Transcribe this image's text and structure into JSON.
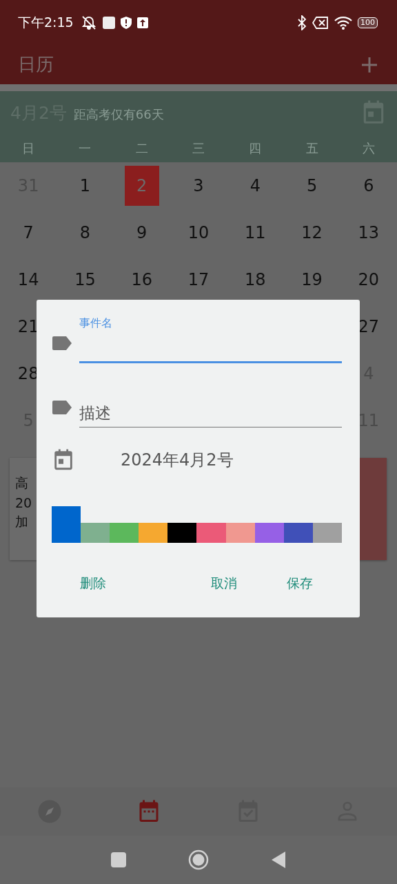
{
  "status_bar": {
    "time": "下午2:15",
    "battery": "100"
  },
  "app_bar": {
    "title": "日历"
  },
  "header": {
    "date": "4月2号",
    "countdown": "距高考仅有66天",
    "weekdays": [
      "日",
      "一",
      "二",
      "三",
      "四",
      "五",
      "六"
    ]
  },
  "calendar": {
    "rows": [
      {
        "cells": [
          {
            "day": "31",
            "other_month": true,
            "selected": false
          },
          {
            "day": "1",
            "other_month": false,
            "selected": false
          },
          {
            "day": "2",
            "other_month": false,
            "selected": true
          },
          {
            "day": "3",
            "other_month": false,
            "selected": false
          },
          {
            "day": "4",
            "other_month": false,
            "selected": false
          },
          {
            "day": "5",
            "other_month": false,
            "selected": false
          },
          {
            "day": "6",
            "other_month": false,
            "selected": false
          }
        ]
      },
      {
        "cells": [
          {
            "day": "7",
            "other_month": false,
            "selected": false
          },
          {
            "day": "8",
            "other_month": false,
            "selected": false
          },
          {
            "day": "9",
            "other_month": false,
            "selected": false
          },
          {
            "day": "10",
            "other_month": false,
            "selected": false
          },
          {
            "day": "11",
            "other_month": false,
            "selected": false
          },
          {
            "day": "12",
            "other_month": false,
            "selected": false
          },
          {
            "day": "13",
            "other_month": false,
            "selected": false
          }
        ]
      },
      {
        "cells": [
          {
            "day": "14",
            "other_month": false,
            "selected": false
          },
          {
            "day": "15",
            "other_month": false,
            "selected": false
          },
          {
            "day": "16",
            "other_month": false,
            "selected": false
          },
          {
            "day": "17",
            "other_month": false,
            "selected": false
          },
          {
            "day": "18",
            "other_month": false,
            "selected": false
          },
          {
            "day": "19",
            "other_month": false,
            "selected": false
          },
          {
            "day": "20",
            "other_month": false,
            "selected": false
          }
        ]
      },
      {
        "left": {
          "day": "21",
          "other_month": false,
          "selected": false
        },
        "right": {
          "day": "27",
          "other_month": false,
          "selected": false
        }
      },
      {
        "left": {
          "day": "28",
          "other_month": false,
          "selected": false
        },
        "right": {
          "day": "4",
          "other_month": true,
          "selected": false
        }
      },
      {
        "left": {
          "day": "5",
          "other_month": true,
          "selected": false
        },
        "right": {
          "day": "11",
          "other_month": true,
          "selected": false
        }
      }
    ]
  },
  "event_card": {
    "lines": [
      "高",
      "20",
      "加"
    ]
  },
  "dialog": {
    "name_field": {
      "label": "事件名",
      "focused": true
    },
    "description_field": {
      "placeholder": "描述"
    },
    "date": "2024年4月2号",
    "colors": [
      {
        "color": "#0066cc",
        "selected": true
      },
      {
        "color": "#7fb08f",
        "selected": false
      },
      {
        "color": "#5cb85c",
        "selected": false
      },
      {
        "color": "#f5a830",
        "selected": false
      },
      {
        "color": "#000000",
        "selected": false
      },
      {
        "color": "#eb5a78",
        "selected": false
      },
      {
        "color": "#f09890",
        "selected": false
      },
      {
        "color": "#9660e6",
        "selected": false
      },
      {
        "color": "#4050b8",
        "selected": false
      },
      {
        "color": "#a0a0a0",
        "selected": false
      }
    ],
    "buttons": [
      {
        "label": "删除",
        "kind": "delete"
      },
      {
        "label": "取消",
        "kind": "cancel"
      },
      {
        "label": "保存",
        "kind": "save"
      }
    ]
  },
  "bottom_nav": [
    {
      "kind": "explore",
      "selected": false
    },
    {
      "kind": "calendar",
      "selected": true
    },
    {
      "kind": "tasks",
      "selected": false
    },
    {
      "kind": "profile",
      "selected": false
    }
  ]
}
